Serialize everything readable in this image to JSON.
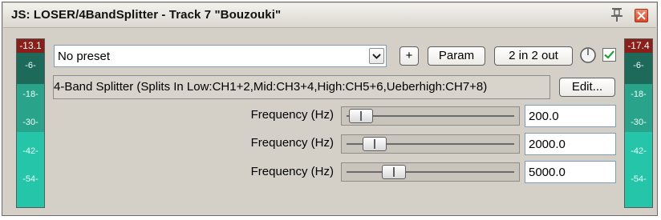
{
  "window": {
    "title": "JS: LOSER/4BandSplitter - Track 7 \"Bouzouki\""
  },
  "meters": {
    "left": {
      "peak": "-13.1",
      "ticks": [
        "-6-",
        "-18-",
        "-30-",
        "-42-",
        "-54-"
      ]
    },
    "right": {
      "peak": "-17.4",
      "ticks": [
        "-6-",
        "-18-",
        "-30-",
        "-42-",
        "-54-"
      ]
    }
  },
  "toolbar": {
    "preset_value": "No preset",
    "add_label": "+",
    "param_label": "Param",
    "io_label": "2 in 2 out",
    "enabled": true
  },
  "plugin": {
    "description": "4-Band Splitter (Splits In Low:CH1+2,Mid:CH3+4,High:CH5+6,Ueberhigh:CH7+8)",
    "edit_label": "Edit..."
  },
  "params": [
    {
      "label": "Frequency (Hz)",
      "value": "200.0",
      "slider_fraction": 0.03
    },
    {
      "label": "Frequency (Hz)",
      "value": "2000.0",
      "slider_fraction": 0.12
    },
    {
      "label": "Frequency (Hz)",
      "value": "5000.0",
      "slider_fraction": 0.25
    }
  ],
  "colors": {
    "meter_peak": "#8a1f1a",
    "meter_fill": "#24c5a9",
    "close_button": "#d74a2c"
  }
}
